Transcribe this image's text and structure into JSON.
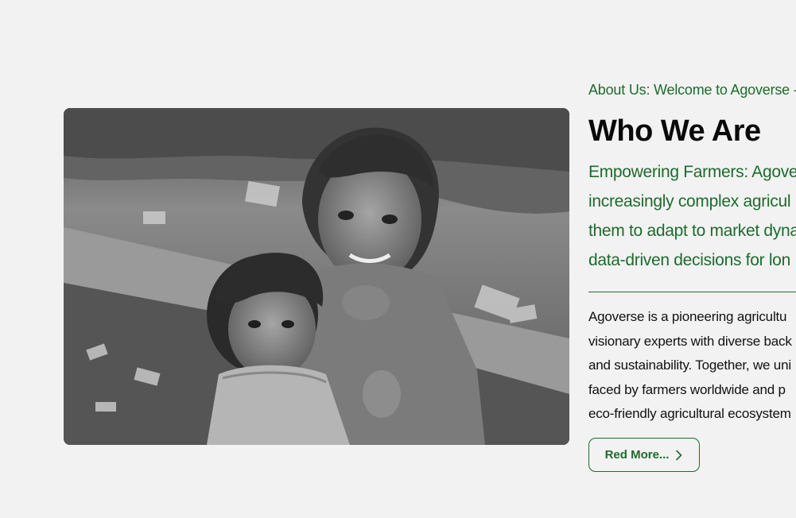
{
  "about": {
    "eyebrow": "About Us: Welcome to Agoverse -",
    "heading": "Who We Are",
    "lead_lines": [
      "Empowering Farmers: Agove",
      "increasingly complex agricul",
      "them to adapt to market dyna",
      "data-driven decisions for lon"
    ],
    "body_lines": [
      "Agoverse is a pioneering agricultu",
      "visionary experts with diverse back",
      "and sustainability. Together, we uni",
      "faced by farmers worldwide and p",
      "eco-friendly agricultural ecosystem"
    ],
    "button_label": "Red More...",
    "button_icon": "chevron-right-icon"
  },
  "image": {
    "subject": "black-and-white photo of two children sitting on the ground",
    "style": "grayscale"
  },
  "colors": {
    "accent_green": "#1e6b2d",
    "background": "#f2f2f2",
    "heading": "#0a0a0a"
  }
}
